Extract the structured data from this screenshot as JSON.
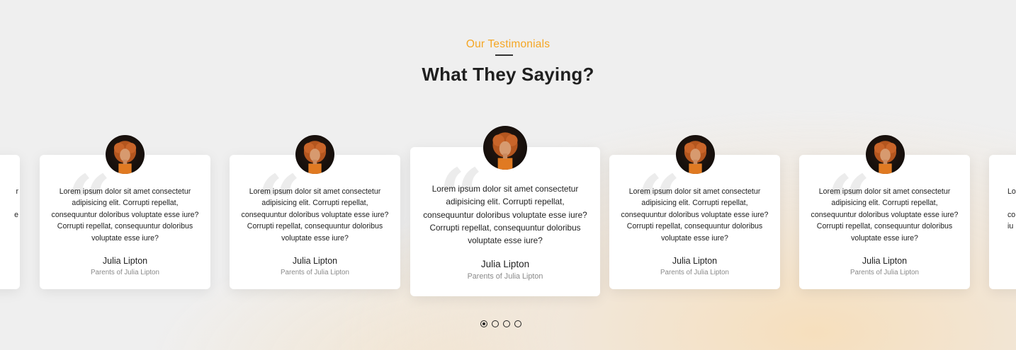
{
  "section": {
    "eyebrow": "Our Testimonials",
    "title": "What They Saying?"
  },
  "testimonials": [
    {
      "text": "Lorem ipsum dolor sit amet consectetur adipisicing elit. Corrupti repellat, consequuntur doloribus voluptate esse iure?Corrupti repellat, consequuntur doloribus voluptate esse iure?",
      "name": "Julia Lipton",
      "role": "Parents of Julia Lipton"
    },
    {
      "text": "Lorem ipsum dolor sit amet consectetur adipisicing elit. Corrupti repellat, consequuntur doloribus voluptate esse iure?Corrupti repellat, consequuntur doloribus voluptate esse iure?",
      "name": "Julia Lipton",
      "role": "Parents of Julia Lipton"
    },
    {
      "text": "Lorem ipsum dolor sit amet consectetur adipisicing elit. Corrupti repellat, consequuntur doloribus voluptate esse iure?Corrupti repellat, consequuntur doloribus voluptate esse iure?",
      "name": "Julia Lipton",
      "role": "Parents of Julia Lipton"
    },
    {
      "text": "Lorem ipsum dolor sit amet consectetur adipisicing elit. Corrupti repellat, consequuntur doloribus voluptate esse iure?Corrupti repellat, consequuntur doloribus voluptate esse iure?",
      "name": "Julia Lipton",
      "role": "Parents of Julia Lipton"
    },
    {
      "text": "Lorem ipsum dolor sit amet consectetur adipisicing elit. Corrupti repellat, consequuntur doloribus voluptate esse iure?Corrupti repellat, consequuntur doloribus voluptate esse iure?",
      "name": "Julia Lipton",
      "role": "Parents of Julia Lipton"
    }
  ],
  "partial_cards": {
    "left_lines": [
      "r",
      "",
      "e",
      ""
    ],
    "right_lines": [
      "Lo",
      "",
      "co",
      "iu"
    ]
  },
  "pagination": {
    "pages": 4,
    "active": 1
  },
  "colors": {
    "accent": "#f5a623",
    "heading": "#1f1f1f",
    "muted": "#8a8a8a"
  },
  "icons": {
    "quote": "quote-icon",
    "avatar": "avatar-photo"
  }
}
